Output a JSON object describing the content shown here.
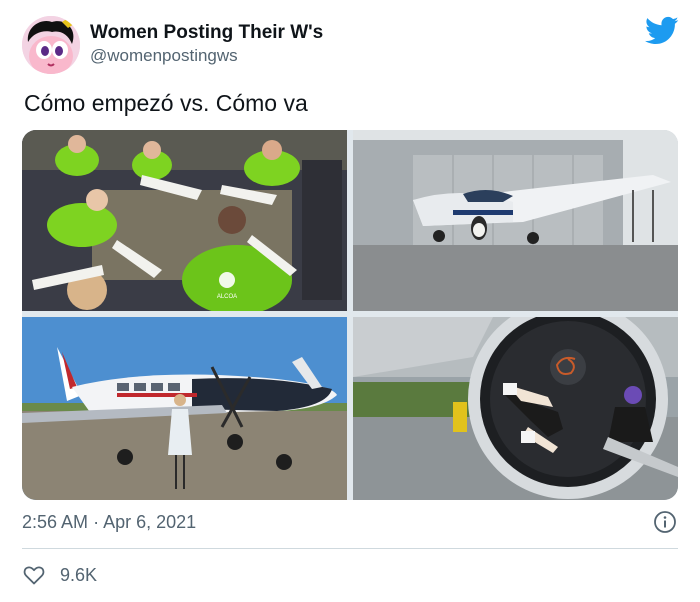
{
  "author": {
    "name": "Women Posting Their W's",
    "handle": "@womenpostingws",
    "avatar_icon": "powerpuff-avatar"
  },
  "brand": {
    "icon": "twitter-bird-icon",
    "color": "#1d9bf0"
  },
  "tweet": {
    "text": "Cómo empezó vs. Cómo va",
    "time": "2:56 AM",
    "separator": "·",
    "date": "Apr 6, 2021"
  },
  "media": {
    "photos": [
      {
        "label": "ALCOA"
      },
      {
        "label": ""
      },
      {
        "label": ""
      },
      {
        "label": ""
      }
    ]
  },
  "engagement": {
    "like_icon": "heart-icon",
    "likes": "9.6K"
  },
  "colors": {
    "text": "#0f1419",
    "secondary": "#536471",
    "divider": "#cfd9de"
  }
}
